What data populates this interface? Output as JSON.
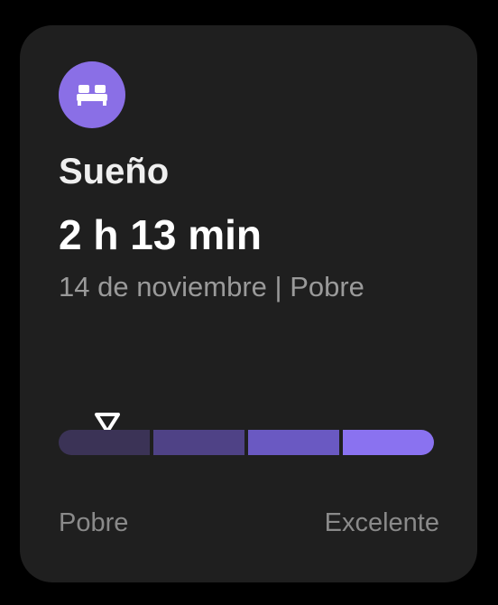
{
  "card": {
    "icon": "bed-icon",
    "title": "Sueño",
    "duration": "2 h 13 min",
    "subtitle": "14 de noviembre | Pobre",
    "scale": {
      "segments": [
        "#3b3356",
        "#4f4286",
        "#6a59c2",
        "#8a72f0"
      ],
      "marker_level": 0.13,
      "label_min": "Pobre",
      "label_max": "Excelente"
    },
    "accent_color": "#8a6fe6"
  }
}
